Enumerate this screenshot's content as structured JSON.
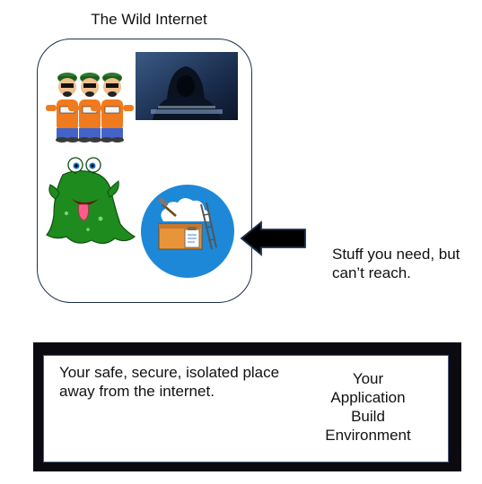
{
  "internet": {
    "title": "The Wild Internet",
    "images": [
      "beagle-boys-icon",
      "hooded-hacker-icon",
      "green-monster-icon",
      "cloud-build-toolbox-icon"
    ]
  },
  "callout": {
    "arrow_icon": "left-arrow-icon",
    "text": "Stuff you need, but can’t reach."
  },
  "environment": {
    "description": "Your safe, secure, isolated place away from the internet.",
    "badge_lines": [
      "Your",
      "Application",
      "Build",
      "Environment"
    ]
  },
  "colors": {
    "badge_fill": "#ffff00",
    "badge_stroke": "#8c8c00",
    "circle_fill": "#1e88d8",
    "env_border": "#0a0a10",
    "monster": "#1e8b1e",
    "beagle_shirt": "#f07a1e",
    "beagle_pants": "#4363c8"
  }
}
